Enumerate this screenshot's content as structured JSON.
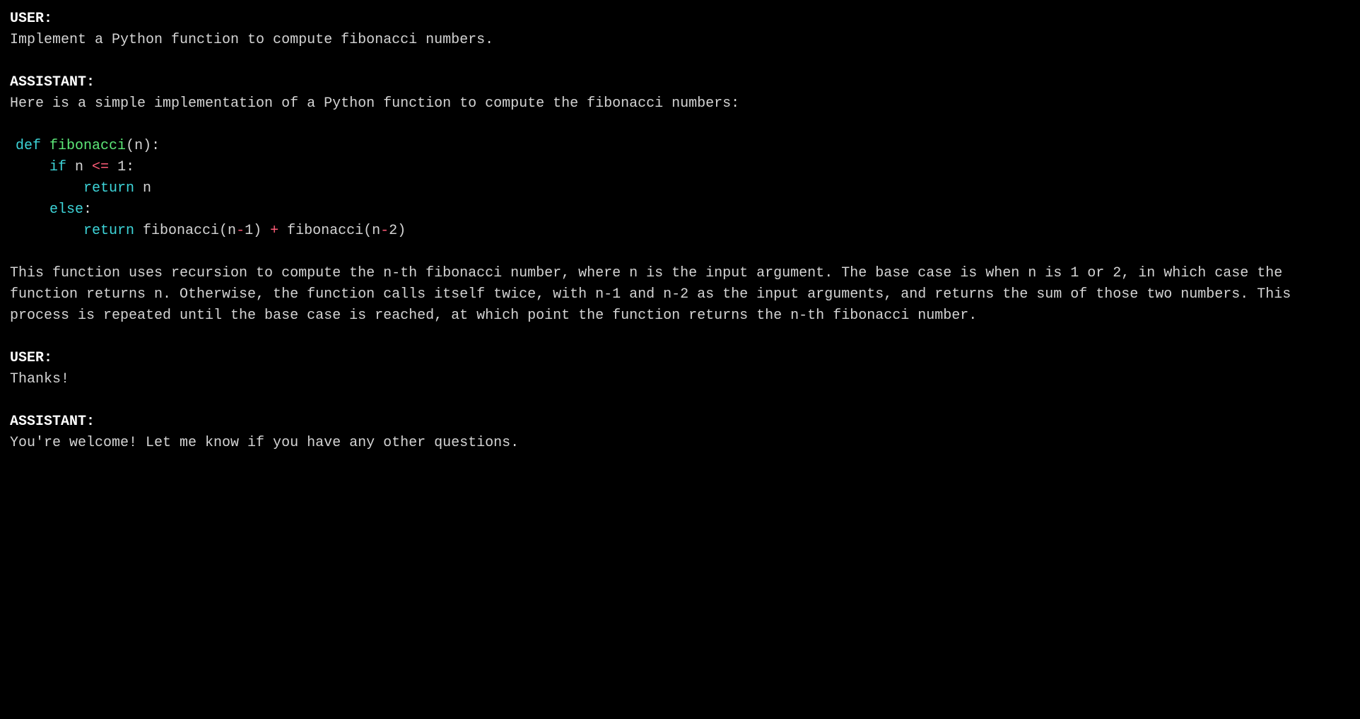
{
  "conversation": [
    {
      "role": "USER:",
      "text": "Implement a Python function to compute fibonacci numbers."
    },
    {
      "role": "ASSISTANT:",
      "intro": "Here is a simple implementation of a Python function to compute the fibonacci numbers:",
      "code_tokens": [
        {
          "t": "def",
          "c": "kw"
        },
        {
          "t": " ",
          "c": "pn"
        },
        {
          "t": "fibonacci",
          "c": "fn"
        },
        {
          "t": "(n):",
          "c": "pn"
        },
        {
          "t": "\n    ",
          "c": "pn"
        },
        {
          "t": "if",
          "c": "kw"
        },
        {
          "t": " n ",
          "c": "id"
        },
        {
          "t": "<=",
          "c": "op"
        },
        {
          "t": " ",
          "c": "pn"
        },
        {
          "t": "1",
          "c": "num"
        },
        {
          "t": ":",
          "c": "pn"
        },
        {
          "t": "\n        ",
          "c": "pn"
        },
        {
          "t": "return",
          "c": "kw"
        },
        {
          "t": " n",
          "c": "id"
        },
        {
          "t": "\n    ",
          "c": "pn"
        },
        {
          "t": "else",
          "c": "kw"
        },
        {
          "t": ":",
          "c": "pn"
        },
        {
          "t": "\n        ",
          "c": "pn"
        },
        {
          "t": "return",
          "c": "kw"
        },
        {
          "t": " fibonacci(n",
          "c": "id"
        },
        {
          "t": "-",
          "c": "op"
        },
        {
          "t": "1",
          "c": "num"
        },
        {
          "t": ") ",
          "c": "pn"
        },
        {
          "t": "+",
          "c": "op"
        },
        {
          "t": " fibonacci(n",
          "c": "id"
        },
        {
          "t": "-",
          "c": "op"
        },
        {
          "t": "2",
          "c": "num"
        },
        {
          "t": ")",
          "c": "pn"
        }
      ],
      "explanation": "This function uses recursion to compute the n-th fibonacci number, where n is the input argument. The base case is when n is 1 or 2, in which case the function returns n. Otherwise, the function calls itself twice, with n-1 and n-2 as the input arguments, and returns the sum of those two numbers. This process is repeated until the base case is reached, at which point the function returns the n-th fibonacci number."
    },
    {
      "role": "USER:",
      "text": "Thanks!"
    },
    {
      "role": "ASSISTANT:",
      "text": "You're welcome! Let me know if you have any other questions."
    }
  ]
}
